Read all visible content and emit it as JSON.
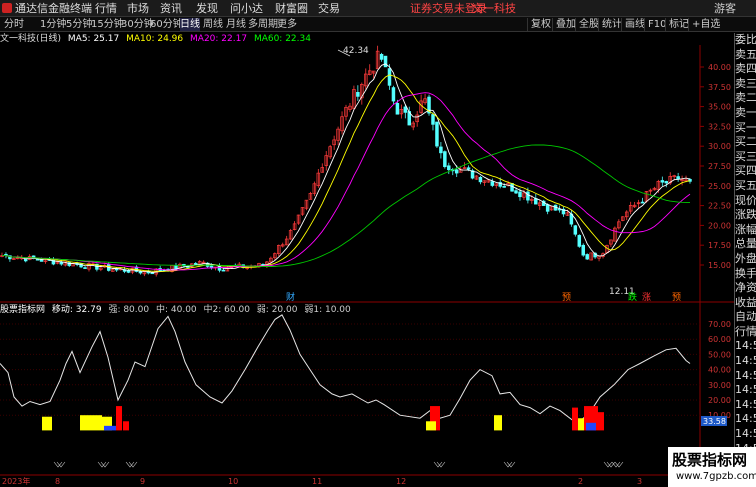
{
  "topbar": {
    "app_title": "通达信金融终端",
    "menus": [
      "行情",
      "市场",
      "资讯",
      "发现",
      "问小达",
      "财富圈",
      "交易"
    ],
    "notice": "证券交易未登录",
    "stock": "文一科技",
    "user": "游客"
  },
  "toolbar": {
    "periods": [
      "分时",
      "1分钟",
      "5分钟",
      "15分钟",
      "30分钟",
      "60分钟",
      "日线",
      "周线",
      "月线",
      "多周期",
      "更多"
    ],
    "active_period": "日线",
    "buttons": [
      "复权",
      "叠加",
      "全股",
      "统计",
      "画线",
      "F10",
      "标记",
      "+自选"
    ]
  },
  "chart": {
    "title": "文一科技(日线)",
    "ma": [
      {
        "label": "MA5: 25.17",
        "color": "#ffffff"
      },
      {
        "label": "MA10: 24.96",
        "color": "#ffff00"
      },
      {
        "label": "MA20: 22.17",
        "color": "#ff00ff"
      },
      {
        "label": "MA60: 22.34",
        "color": "#00ff00"
      }
    ],
    "high_label": "42.34",
    "low_label": "12.11",
    "price_axis": [
      "40.00",
      "37.50",
      "35.00",
      "32.50",
      "30.00",
      "27.50",
      "25.00",
      "22.50",
      "20.00",
      "17.50",
      "15.00"
    ],
    "markers": [
      "财",
      "预",
      "跌",
      "涨",
      "预"
    ]
  },
  "indicator": {
    "title": "股票指标网",
    "labels": [
      "移动: 32.79",
      "强: 80.00",
      "中: 40.00",
      "中2: 60.00",
      "弱: 20.00",
      "弱1: 10.00"
    ],
    "axis": [
      "70.00",
      "60.00",
      "50.00",
      "40.00",
      "30.00",
      "20.00",
      "10.00"
    ],
    "current": "33.58"
  },
  "x_axis": [
    "2023年",
    "8",
    "9",
    "10",
    "11",
    "12",
    "2",
    "3"
  ],
  "right_panel": [
    "委比",
    "卖五",
    "卖四",
    "卖三",
    "卖二",
    "卖一",
    "买一",
    "买二",
    "买三",
    "买四",
    "买五",
    "现价",
    "涨跌",
    "涨幅",
    "总量",
    "外盘",
    "换手",
    "净资",
    "收益",
    "自动",
    "行情",
    "14:56",
    "14:56",
    "14:56",
    "14:56",
    "14:56",
    "14:56",
    "14:56",
    "14:56"
  ],
  "watermark": {
    "title": "股票指标网",
    "url": "www.7gpzb.com"
  }
}
